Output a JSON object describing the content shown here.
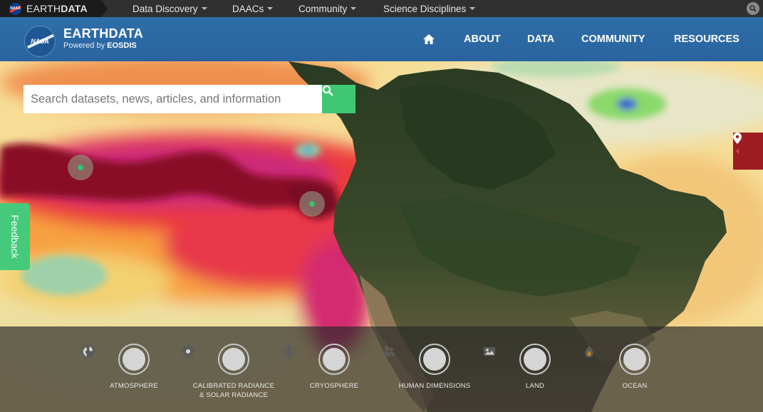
{
  "topbar": {
    "brand_light": "EARTH",
    "brand_bold": "DATA",
    "nasa_mini": "NASA",
    "menu": [
      {
        "label": "Data Discovery"
      },
      {
        "label": "DAACs"
      },
      {
        "label": "Community"
      },
      {
        "label": "Science Disciplines"
      }
    ],
    "search_icon": "search-icon"
  },
  "header": {
    "logo_mark": "NASA",
    "title": "EARTHDATA",
    "subtitle_prefix": "Powered by ",
    "subtitle_bold": "EOSDIS",
    "nav": [
      {
        "label": "ABOUT"
      },
      {
        "label": "DATA"
      },
      {
        "label": "COMMUNITY"
      },
      {
        "label": "RESOURCES"
      }
    ],
    "home_icon": "home-icon"
  },
  "hero": {
    "search_placeholder": "Search datasets, news, articles, and information",
    "feedback_label": "Feedback",
    "pin_icon": "map-pin-icon"
  },
  "disciplines": [
    {
      "label": "ATMOSPHERE",
      "icon": "globe-icon"
    },
    {
      "label": "CALIBRATED RADIANCE",
      "label2": "& SOLAR RADIANCE",
      "icon": "gear-icon"
    },
    {
      "label": "CRYOSPHERE",
      "icon": "snowflake-icon"
    },
    {
      "label": "HUMAN DIMENSIONS",
      "icon": "people-icon"
    },
    {
      "label": "LAND",
      "icon": "landscape-icon"
    },
    {
      "label": "OCEAN",
      "icon": "water-drop-icon"
    }
  ],
  "colors": {
    "header_blue": "#2c69a4",
    "accent_green": "#3fc773",
    "pin_red": "#9c1c22"
  }
}
